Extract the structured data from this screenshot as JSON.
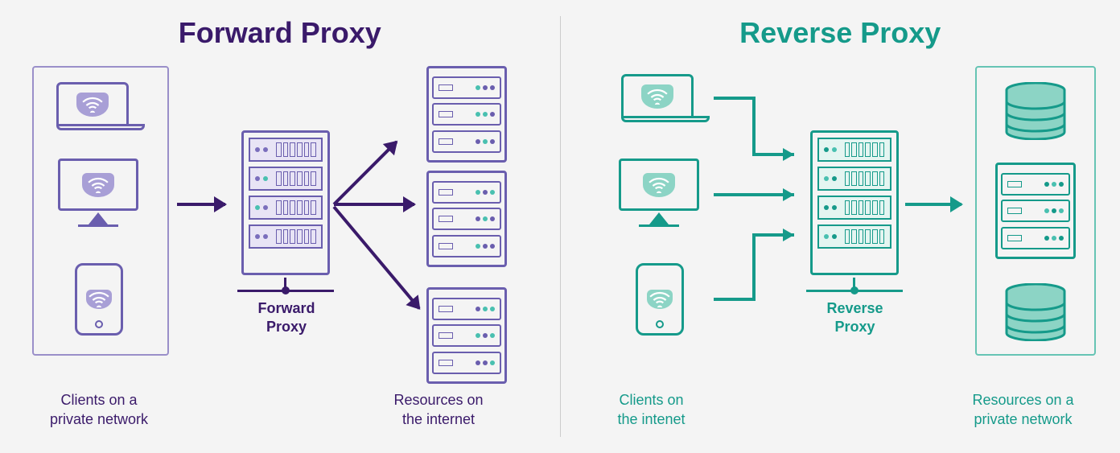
{
  "forward": {
    "title": "Forward Proxy",
    "clients_label": "Clients on a\nprivate network",
    "proxy_label": "Forward\nProxy",
    "resources_label": "Resources on\nthe internet",
    "icons": {
      "laptop": "laptop-icon",
      "monitor": "monitor-icon",
      "tablet": "tablet-icon",
      "server": "server-icon",
      "wifi": "wifi-icon"
    },
    "colors": {
      "primary": "#3a1a6a",
      "secondary": "#6a5eae",
      "fill": "#a89fd6",
      "accent": "#49c0b0"
    }
  },
  "reverse": {
    "title": "Reverse Proxy",
    "clients_label": "Clients on\nthe intenet",
    "proxy_label": "Reverse\nProxy",
    "resources_label": "Resources on a\nprivate network",
    "icons": {
      "laptop": "laptop-icon",
      "monitor": "monitor-icon",
      "phone": "phone-icon",
      "database": "database-icon",
      "server": "server-icon",
      "wifi": "wifi-icon"
    },
    "colors": {
      "primary": "#159a8a",
      "secondary": "#66c4b4",
      "fill": "#8cd4c5",
      "accent": "#49c0b0"
    }
  }
}
